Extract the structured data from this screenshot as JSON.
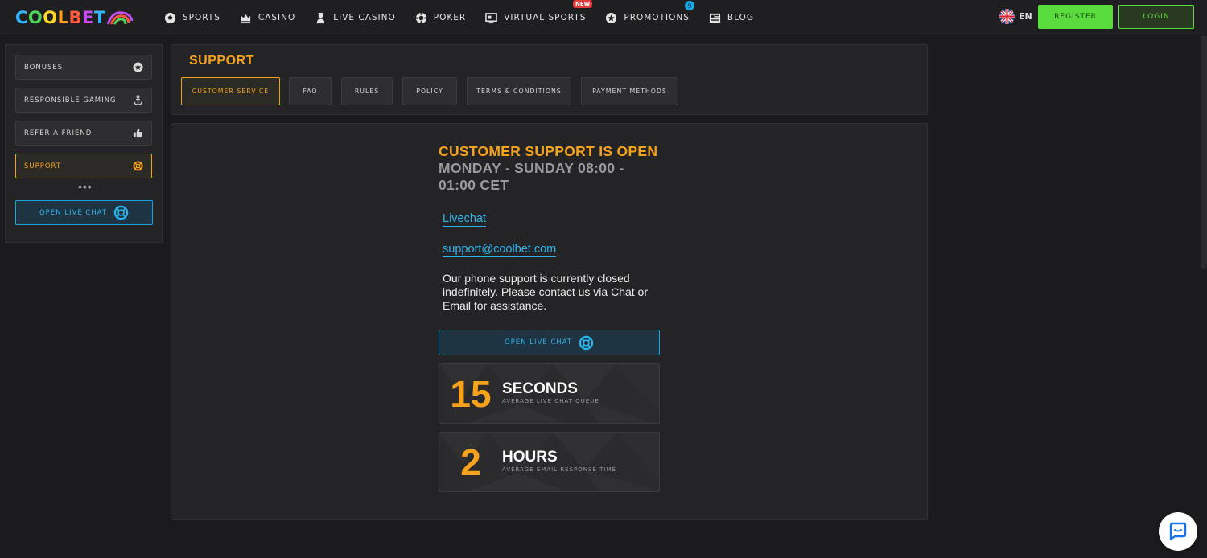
{
  "brand": {
    "logo_text": [
      "C",
      "O",
      "O",
      "L",
      "B",
      "E",
      "T"
    ],
    "colors": {
      "accent_orange": "#f7a21b",
      "accent_blue": "#2bb4ee",
      "accent_green": "#59dd3c"
    }
  },
  "header": {
    "nav": [
      {
        "label": "SPORTS",
        "icon": "soccer-ball-icon"
      },
      {
        "label": "CASINO",
        "icon": "slot-crown-icon"
      },
      {
        "label": "LIVE CASINO",
        "icon": "dealer-icon"
      },
      {
        "label": "POKER",
        "icon": "poker-chip-icon"
      },
      {
        "label": "VIRTUAL SPORTS",
        "icon": "monitor-icon",
        "badge": "NEW"
      },
      {
        "label": "PROMOTIONS",
        "icon": "star-icon",
        "badge": "9"
      },
      {
        "label": "BLOG",
        "icon": "newspaper-icon"
      }
    ],
    "language": "EN",
    "register_label": "REGISTER",
    "login_label": "LOGIN"
  },
  "sidebar": {
    "items": [
      {
        "label": "BONUSES",
        "icon": "star-circle-icon"
      },
      {
        "label": "RESPONSIBLE GAMING",
        "icon": "anchor-icon"
      },
      {
        "label": "REFER A FRIEND",
        "icon": "thumbs-up-icon"
      },
      {
        "label": "SUPPORT",
        "icon": "lifebuoy-icon",
        "active": true
      }
    ],
    "more": "•••",
    "chat_button_label": "OPEN LIVE CHAT"
  },
  "support": {
    "title": "SUPPORT",
    "tabs": [
      {
        "label": "CUSTOMER SERVICE",
        "active": true
      },
      {
        "label": "FAQ"
      },
      {
        "label": "RULES"
      },
      {
        "label": "POLICY"
      },
      {
        "label": "TERMS & CONDITIONS"
      },
      {
        "label": "PAYMENT METHODS"
      }
    ]
  },
  "main": {
    "heading": "CUSTOMER SUPPORT IS OPEN",
    "hours": "MONDAY - SUNDAY 08:00 - 01:00 CET",
    "livechat_link": "Livechat",
    "email_link": "support@coolbet.com",
    "notice": "Our phone support is currently closed indefinitely. Please contact us via Chat or Email for assistance.",
    "chat_button_label": "OPEN LIVE CHAT",
    "stats": [
      {
        "number": "15",
        "unit": "SECONDS",
        "desc": "AVERAGE LIVE CHAT QUEUE"
      },
      {
        "number": "2",
        "unit": "HOURS",
        "desc": "AVERAGE EMAIL RESPONSE TIME"
      }
    ]
  }
}
